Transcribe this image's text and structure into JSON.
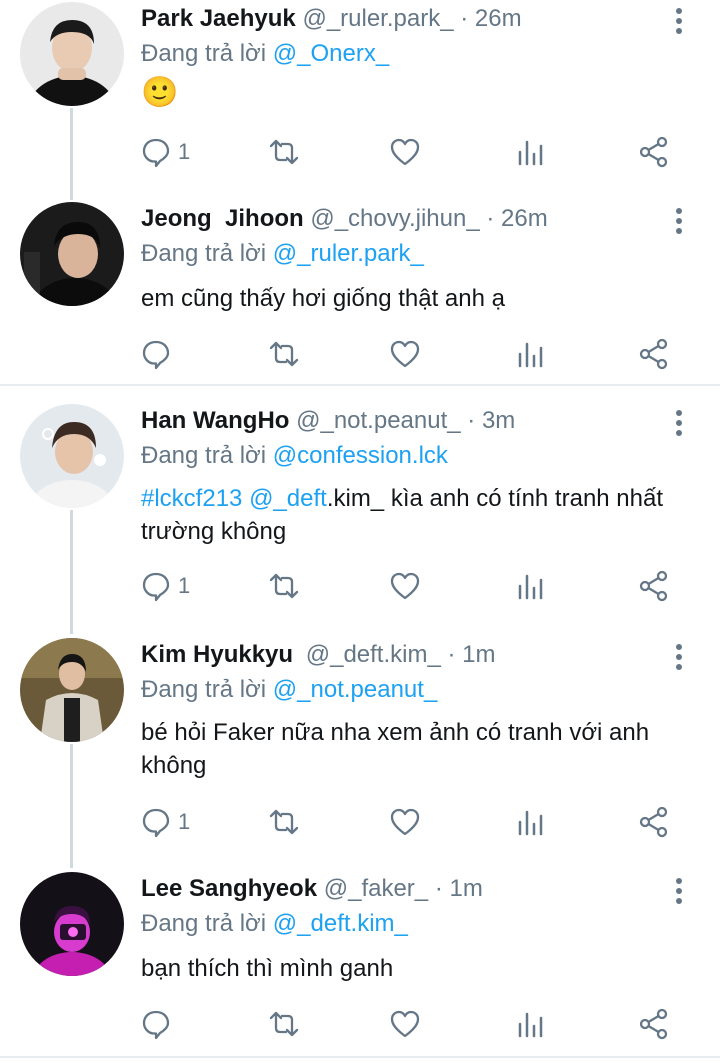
{
  "reply_prefix": "Đang trả lời",
  "tweets": [
    {
      "name": "Park Jaehyuk",
      "handle": "@_ruler.park_",
      "time": "26m",
      "reply_to": "@_Onerx_",
      "text": "🙂",
      "reply_count": "1"
    },
    {
      "name": "Jeong  Jihoon",
      "handle": "@_chovy.jihun_",
      "time": "26m",
      "reply_to": "@_ruler.park_",
      "text": "em cũng thấy hơi giống thật anh ạ",
      "reply_count": ""
    },
    {
      "name": "Han WangHo",
      "handle": "@_not.peanut_",
      "time": "3m",
      "reply_to": "@confession.lck",
      "hashtag": "#lckcf213",
      "mention": "@_deft",
      "text_rest": ".kim_ kìa anh có tính tranh nhất trường không",
      "reply_count": "1"
    },
    {
      "name": "Kim Hyukkyu",
      "handle": "@_deft.kim_",
      "time": "1m",
      "reply_to": "@_not.peanut_",
      "text": "bé hỏi Faker nữa nha xem ảnh có tranh với anh không",
      "reply_count": "1"
    },
    {
      "name": "Lee Sanghyeok",
      "handle": "@_faker_",
      "time": "1m",
      "reply_to": "@_deft.kim_",
      "text": "bạn thích thì mình ganh",
      "reply_count": ""
    }
  ],
  "colors": {
    "link": "#1da1f2",
    "muted": "#657786",
    "text": "#14171a",
    "thread_line": "#cfd9de"
  },
  "icons": [
    "reply-icon",
    "retweet-icon",
    "like-icon",
    "analytics-icon",
    "share-icon",
    "more-icon"
  ]
}
